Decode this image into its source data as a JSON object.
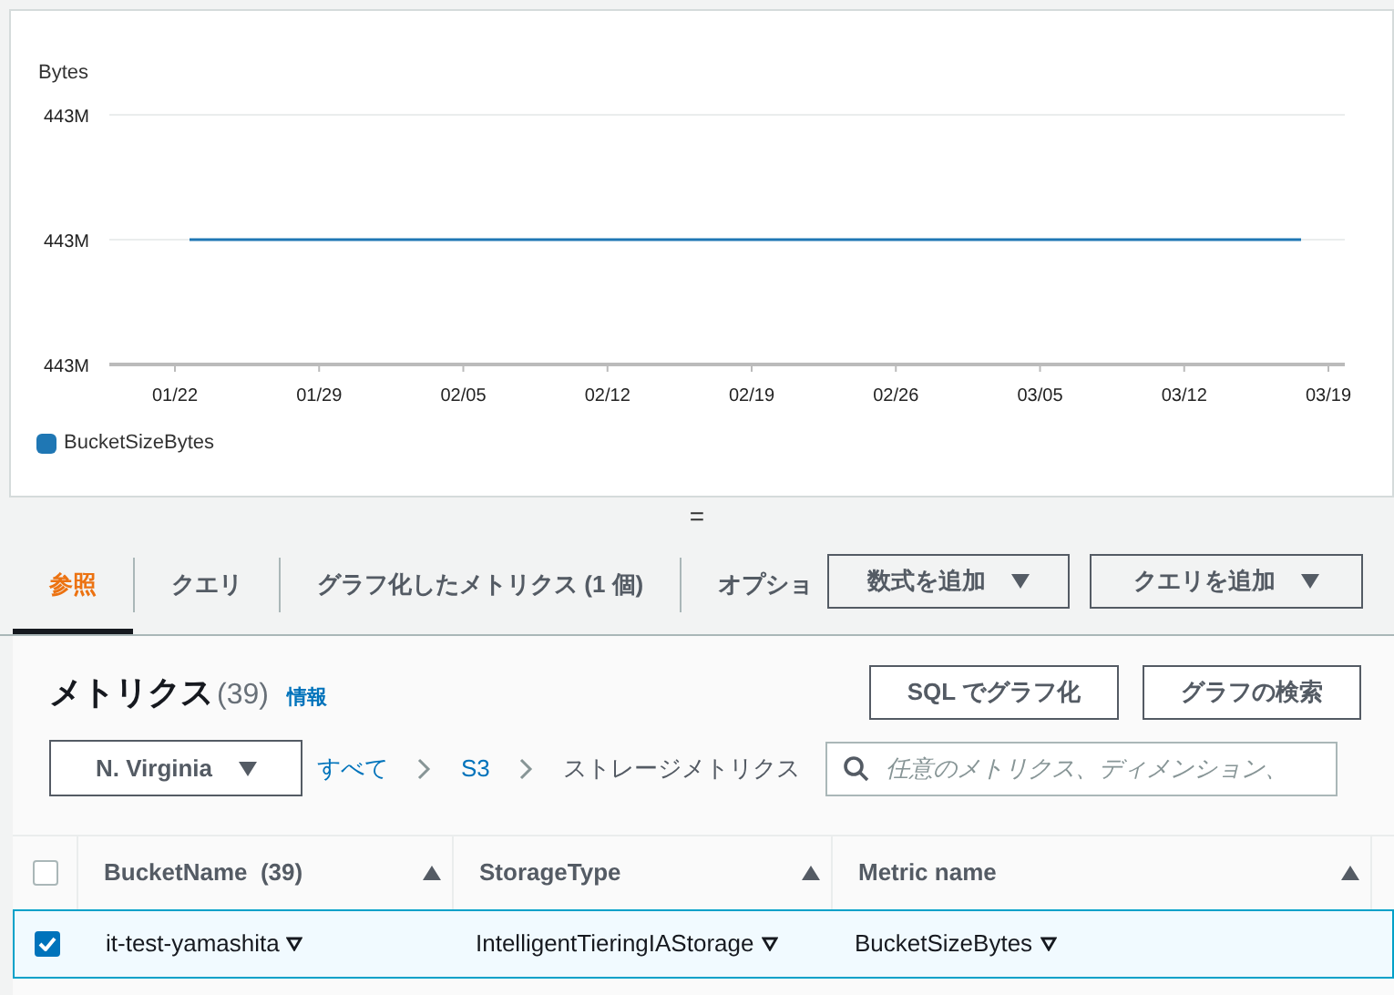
{
  "chart": {
    "ylabel": "Bytes",
    "y_tick_labels": [
      "443M",
      "443M",
      "443M"
    ],
    "x_tick_labels": [
      "01/22",
      "01/29",
      "02/05",
      "02/12",
      "02/19",
      "02/26",
      "03/05",
      "03/12",
      "03/19"
    ],
    "legend": [
      {
        "name": "BucketSizeBytes",
        "color": "#1f77b4"
      }
    ]
  },
  "resize_handle": "=",
  "tabs": [
    {
      "label": "参照",
      "selected": true
    },
    {
      "label": "クエリ",
      "selected": false
    },
    {
      "label": "グラフ化したメトリクス (1 個)",
      "selected": false
    },
    {
      "label": "オプショ",
      "selected": false
    }
  ],
  "tab_buttons": [
    {
      "label": "数式を追加",
      "caret": true
    },
    {
      "label": "クエリを追加",
      "caret": true
    }
  ],
  "metrics": {
    "title": "メトリクス",
    "count": "(39)",
    "info": "情報",
    "buttons": [
      "SQL でグラフ化",
      "グラフの検索"
    ],
    "region": "N. Virginia",
    "breadcrumb": [
      {
        "label": "すべて",
        "link": true
      },
      {
        "label": "S3",
        "link": true
      },
      {
        "label": "ストレージメトリクス",
        "link": false
      }
    ],
    "search": {
      "placeholder": "任意のメトリクス、ディメンション、"
    }
  },
  "table": {
    "all_checked": false,
    "columns": [
      "BucketName  (39)",
      "StorageType",
      "Metric name"
    ],
    "rows": [
      {
        "selected": true,
        "cells": [
          "it-test-yamashita",
          "IntelligentTieringIAStorage",
          "BucketSizeBytes"
        ]
      }
    ]
  }
}
